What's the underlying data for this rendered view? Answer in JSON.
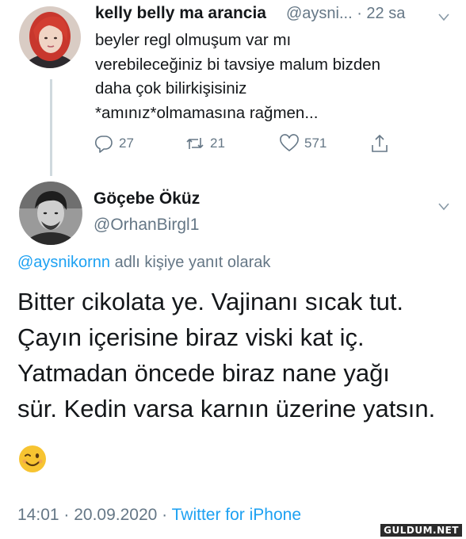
{
  "parent_tweet": {
    "author_name": "kelly belly ma arancia",
    "handle_time": "@aysni... · 22 sa",
    "lines": [
      "beyler regl olmuşum var mı",
      "verebileceğiniz bi tavsiye malum bizden",
      "daha çok bilirkişisiniz",
      "*amınız*olmamasına rağmen..."
    ],
    "reply_count": "27",
    "retweet_count": "21",
    "like_count": "571",
    "icons": [
      "reply-icon",
      "retweet-icon",
      "like-icon",
      "share-icon",
      "chevron-down-icon"
    ]
  },
  "reply_tweet": {
    "author_name": "Göçebe Öküz",
    "handle": "@OrhanBirgl1",
    "reply_to_handle": "@aysnikornn",
    "reply_to_suffix": " adlı kişiye yanıt olarak",
    "lines": [
      "Bitter cikolata ye. Vajinanı sıcak tut.",
      "Çayın içerisine biraz viski kat iç.",
      "Yatmadan öncede biraz nane yağı",
      "sür. Kedin varsa karnın üzerine yatsın."
    ],
    "emoji_name": "winking-face-emoji",
    "timestamp": "14:01 · 20.09.2020 · ",
    "source": "Twitter for iPhone"
  },
  "watermark": "GULDUM.NET",
  "colors": {
    "text": "#14171a",
    "secondary": "#657786",
    "link": "#1da1f2",
    "thread_line": "#cfd9de"
  }
}
